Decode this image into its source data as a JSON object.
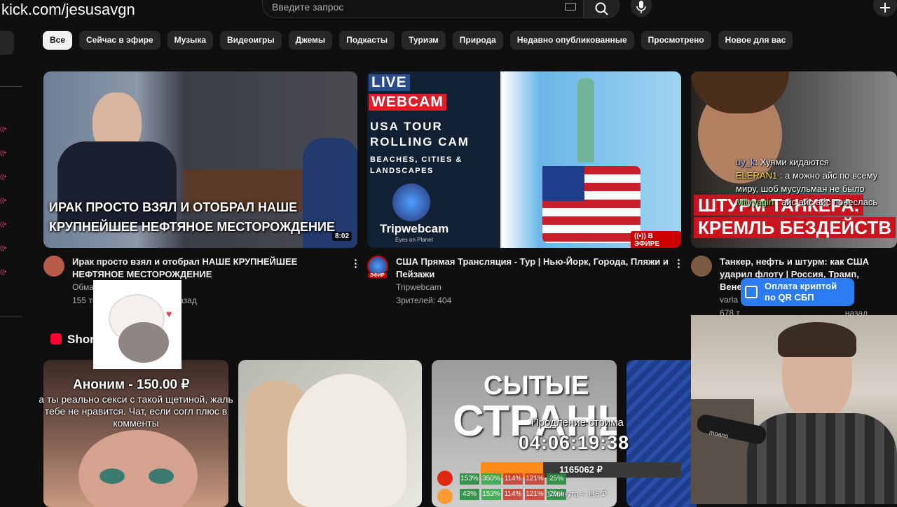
{
  "address_bar": {
    "url": "kick.com/jesusavgn"
  },
  "search": {
    "placeholder": "Введите запрос"
  },
  "chips": [
    "Все",
    "Сейчас в эфире",
    "Музыка",
    "Видеоигры",
    "Джемы",
    "Подкасты",
    "Туризм",
    "Природа",
    "Недавно опубликованные",
    "Просмотрено",
    "Новое для вас"
  ],
  "videos": [
    {
      "thumb_caption_1": "ИРАК ПРОСТО ВЗЯЛ И ОТОБРАЛ НАШЕ",
      "thumb_caption_2": "КРУПНЕЙШЕЕ НЕФТЯНОЕ МЕСТОРОЖДЕНИЕ",
      "duration": "8:02",
      "title": "Ирак просто взял и отобрал НАШЕ КРУПНЕЙШЕЕ НЕФТЯНОЕ МЕСТОРОЖДЕНИЕ",
      "channel": "Обма",
      "stats": "155 ты",
      "stats_tail": "назад"
    },
    {
      "thumb_live": "LIVE",
      "thumb_webcam": "WEBCAM",
      "thumb_line1": "USA TOUR",
      "thumb_line2": "ROLLING CAM",
      "thumb_line3": "BEACHES, CITIES &",
      "thumb_line4": "LANDSCAPES",
      "thumb_brand": "Tripwebcam",
      "thumb_brand_sub": "Eyes on Planet",
      "live_badge": "В ЭФИРЕ",
      "avatar_badge": "ЭФИР",
      "title": "США Прямая Трансляция - Тур | Нью-Йорк, Города, Пляжи и Пейзажи",
      "channel": "Tripwebcam",
      "stats": "Зрителей: 404"
    },
    {
      "thumb_caption_1": "ШТУРМ ТАНКЕРА.",
      "thumb_caption_2": "КРЕМЛЬ БЕЗДЕЙСТВ",
      "title": "Танкер, нефть и штурм: как США ударил флоту | Россия, Трамп, Венесуэла",
      "channel": "varla",
      "stats": "678 т",
      "stats_tail": "назад"
    }
  ],
  "shorts": {
    "label": "Shor"
  },
  "short_cards": [
    {
      "caption_1": "СЫТЫЕ",
      "caption_2": "СТРАНЫ"
    }
  ],
  "donation": {
    "name": "Аноним - 150.00 ₽",
    "message": "а ты реально секси с такой щетиной, жаль тебе не нравится. Чат, если согл плюс в комменты"
  },
  "chat": [
    {
      "user": "uy_k",
      "text": ": Хуями кидаются",
      "color": "#9fb3ff"
    },
    {
      "user": "ELERAN1",
      "text": " : а можно айс по всему миру, шоб мусульман не было",
      "color": "#f5d94a"
    },
    {
      "user": "Milyyagin",
      "text": " : айс айс айс понеслась",
      "color": "#7cf27c"
    }
  ],
  "crypto_banner": {
    "line1": "Оплата криптой",
    "line2": "по QR СБП"
  },
  "stream_timer": {
    "label": "Продление стрима",
    "time": "04:06:19:38"
  },
  "donation_bar": {
    "amount": "1165062 ₽",
    "fill_percent": 31,
    "rate": "1 минута = 115 ₽"
  },
  "bar_rows": [
    [
      "153%",
      "350%",
      "114%",
      "121%",
      "25%"
    ],
    [
      "43%",
      "153%",
      "114%",
      "121%",
      "25%"
    ]
  ],
  "mic_brand": "moano",
  "colors": {
    "background": "#0f0f0f",
    "chip": "#272727",
    "chip_active": "#f1f1f1",
    "accent_red": "#ff0033",
    "crypto": "#2a7cf0"
  }
}
